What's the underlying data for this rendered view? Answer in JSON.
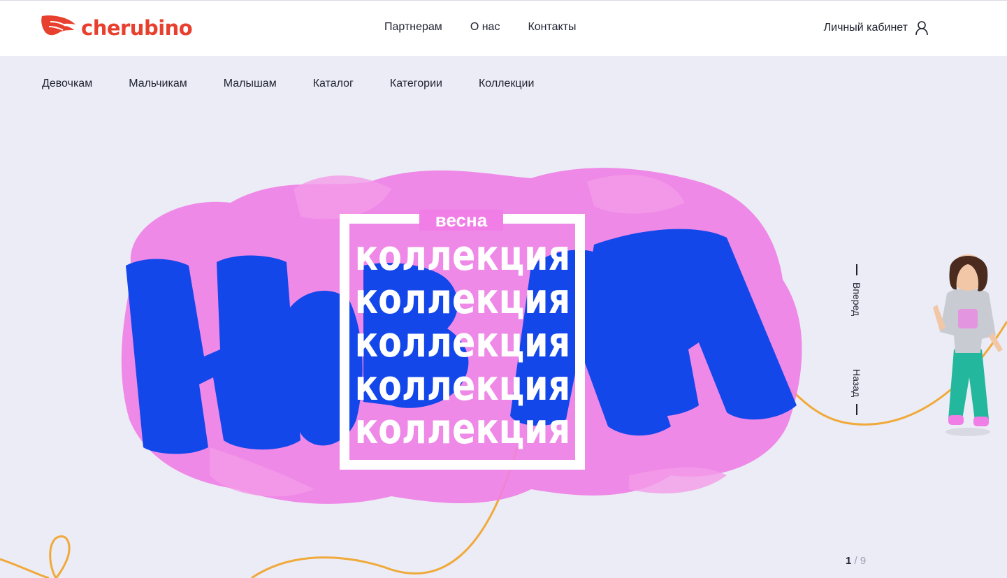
{
  "brand": {
    "name": "cherubino",
    "color": "#e8402f"
  },
  "top_nav": [
    {
      "label": "Партнерам"
    },
    {
      "label": "О нас"
    },
    {
      "label": "Контакты"
    }
  ],
  "account": {
    "label": "Личный кабинет",
    "icon": "user-icon"
  },
  "category_nav": [
    {
      "label": "Девочкам"
    },
    {
      "label": "Мальчикам"
    },
    {
      "label": "Малышам"
    },
    {
      "label": "Каталог"
    },
    {
      "label": "Категории"
    },
    {
      "label": "Коллекции"
    }
  ],
  "hero": {
    "big_word": "новая",
    "season": "весна",
    "lines": [
      "коллекция",
      "коллекция",
      "коллекция",
      "коллекция",
      "коллекция"
    ],
    "colors": {
      "pink": "#f07ee6",
      "blue": "#1447ea",
      "rope": "#f0a93a",
      "background": "#ebecf5"
    }
  },
  "slider": {
    "next_label": "Вперед",
    "prev_label": "Назад",
    "current": "1",
    "separator": "/",
    "total": "9"
  }
}
